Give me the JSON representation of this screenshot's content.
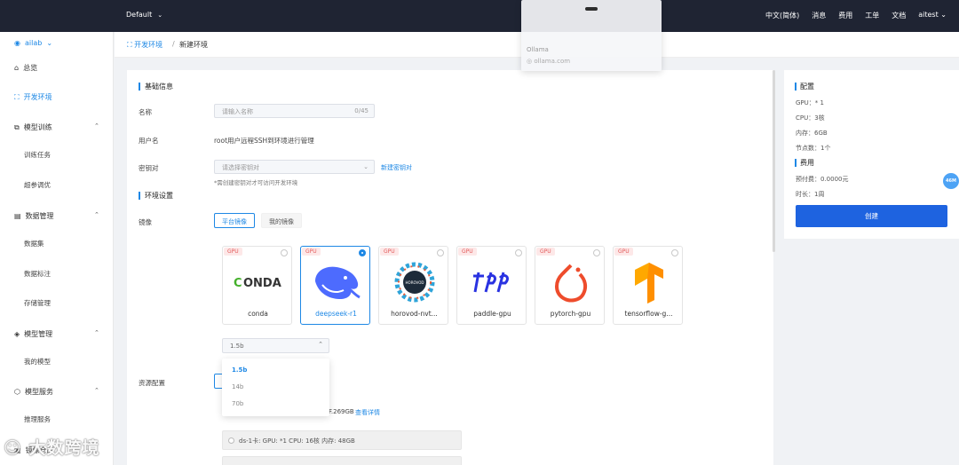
{
  "topbar": {
    "workspace": "Default",
    "links": [
      "中文(简体)",
      "消息",
      "费用",
      "工单",
      "文档",
      "aitest"
    ]
  },
  "popup": {
    "title": "Ollama",
    "url": "ollama.com"
  },
  "sidebar": {
    "location": "ailab",
    "items": [
      {
        "label": "总览"
      },
      {
        "label": "开发环境"
      },
      {
        "label": "模型训练"
      },
      {
        "label": "训练任务"
      },
      {
        "label": "超参调优"
      },
      {
        "label": "数据管理"
      },
      {
        "label": "数据集"
      },
      {
        "label": "数据标注"
      },
      {
        "label": "存储管理"
      },
      {
        "label": "模型管理"
      },
      {
        "label": "我的模型"
      },
      {
        "label": "模型服务"
      },
      {
        "label": "推理服务"
      },
      {
        "label": "镜像仓库"
      }
    ]
  },
  "breadcrumb": {
    "parent": "开发环境",
    "separator": "/",
    "current": "新建环境"
  },
  "form": {
    "basic_title": "基础信息",
    "name_label": "名称",
    "name_placeholder": "请输入名称",
    "name_count": "0/45",
    "user_label": "用户名",
    "user_value": "root用户远程SSH到环境进行管理",
    "keypair_label": "密钥对",
    "keypair_placeholder": "请选择密钥对",
    "keypair_link": "新建密钥对",
    "keypair_hint": "*需创建密钥对才可访问开发环境",
    "env_title": "环境设置",
    "image_label": "镜像",
    "tab_platform": "平台镜像",
    "tab_mine": "我的镜像",
    "gpu_tag": "GPU",
    "images": [
      {
        "name": "conda",
        "selected": false
      },
      {
        "name": "deepseek-r1",
        "selected": true
      },
      {
        "name": "horovod-nvt...",
        "selected": false
      },
      {
        "name": "paddle-gpu",
        "selected": false
      },
      {
        "name": "pytorch-gpu",
        "selected": false
      },
      {
        "name": "tensorflow-g...",
        "selected": false
      }
    ],
    "version_value": "1.5b",
    "version_options": [
      "1.5b",
      "14b",
      "70b"
    ],
    "resource_label": "资源配置",
    "storage_text": "F.269GB",
    "storage_link": "查看详情",
    "resource_rows": [
      {
        "text": "ds-1卡:    GPU: *1    CPU: 16核    内存: 48GB"
      }
    ]
  },
  "summary": {
    "config_title": "配置",
    "gpu": "GPU：* 1",
    "cpu": "CPU：3核",
    "mem": "内存：6GB",
    "nodes": "节点数：1个",
    "fee_title": "费用",
    "prepay": "预付费：0.0000元",
    "duration": "时长：1周",
    "create_label": "创建"
  },
  "float_badge": "46M",
  "watermark": "大数跨境",
  "colors": {
    "accent": "#1e88e5",
    "topbar": "#1f2433",
    "button": "#1e63e0"
  }
}
